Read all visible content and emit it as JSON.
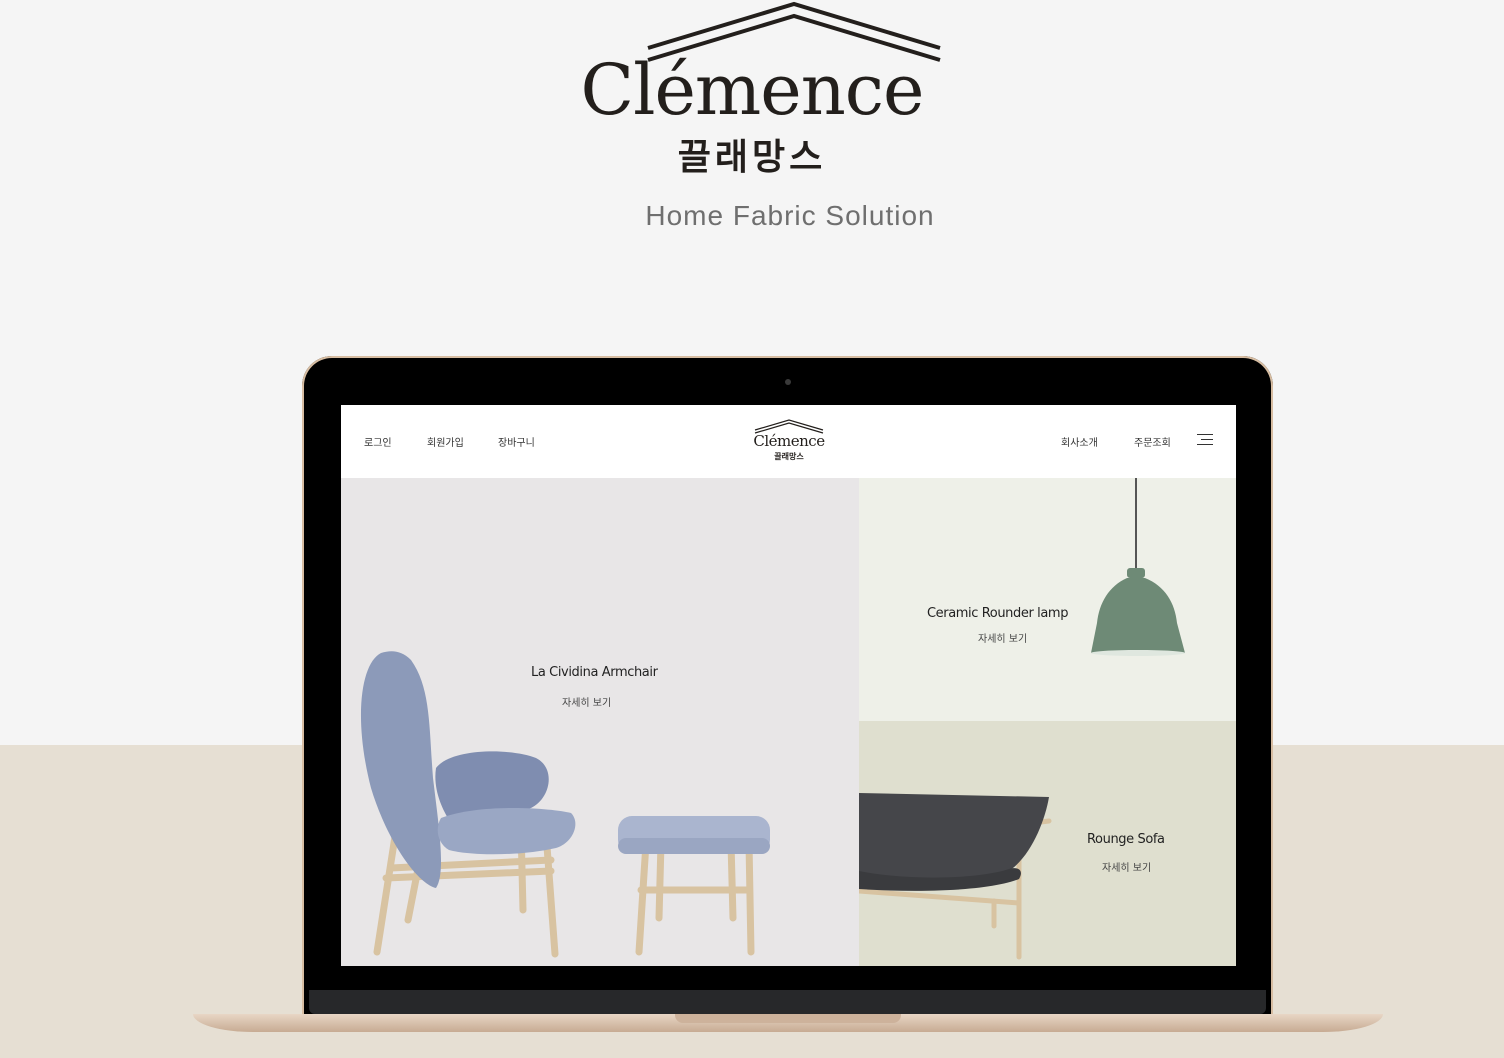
{
  "brand": {
    "name": "Clémence",
    "name_ko": "끌래망스",
    "tagline": "Home Fabric Solution"
  },
  "site": {
    "header": {
      "left_links": [
        "로그인",
        "회원가입",
        "장바구니"
      ],
      "right_links": [
        "회사소개",
        "주문조회"
      ],
      "logo_name": "Clémence",
      "logo_ko": "끌래망스",
      "menu_icon": "hamburger-menu-icon"
    },
    "products": [
      {
        "title": "La Cividina Armchair",
        "link": "자세히 보기"
      },
      {
        "title": "Ceramic Rounder lamp",
        "link": "자세히 보기"
      },
      {
        "title": "Rounge Sofa",
        "link": "자세히 보기"
      }
    ]
  },
  "colors": {
    "page_bg": "#f5f5f5",
    "floor": "#e6dfd3",
    "laptop_gold": "#d7bda2",
    "chair_blue": "#8c9ab9",
    "lamp_green": "#6e8a76",
    "sofa_dark": "#45464a"
  }
}
